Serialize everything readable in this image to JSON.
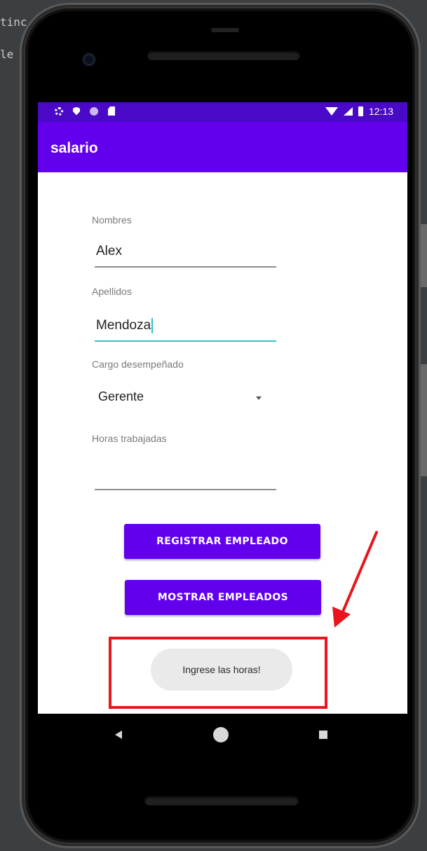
{
  "background": {
    "line1": "tinc",
    "line2": "le"
  },
  "status_bar": {
    "time": "12:13",
    "left_icons": [
      "gear-icon",
      "shield-icon",
      "circle-icon",
      "sim-card-icon"
    ],
    "right_icons": [
      "wifi-icon",
      "signal-icon",
      "battery-icon"
    ]
  },
  "app_bar": {
    "title": "salario",
    "color": "#6200ee"
  },
  "form": {
    "nombres": {
      "label": "Nombres",
      "value": "Alex"
    },
    "apellidos": {
      "label": "Apellidos",
      "value": "Mendoza"
    },
    "cargo": {
      "label": "Cargo desempeñado",
      "selected": "Gerente"
    },
    "horas": {
      "label": "Horas trabajadas",
      "value": ""
    }
  },
  "buttons": {
    "registrar": "REGISTRAR EMPLEADO",
    "mostrar": "MOSTRAR EMPLEADOS"
  },
  "toast": {
    "message": "Ingrese las horas!"
  },
  "annotation": {
    "color": "#e8161c"
  },
  "nav_bar": {
    "icons": [
      "back-icon",
      "home-icon",
      "recents-icon"
    ]
  }
}
